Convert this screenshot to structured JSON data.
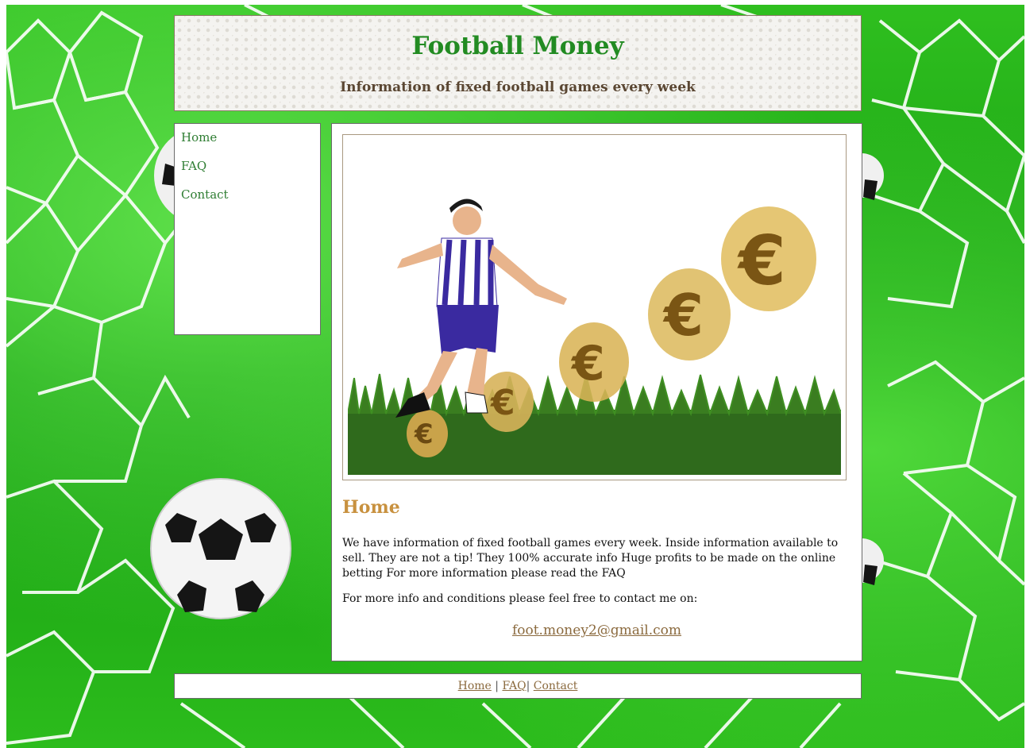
{
  "header": {
    "title": "Football Money",
    "tagline": "Information of fixed football games every week"
  },
  "sidebar": {
    "items": [
      {
        "label": "Home"
      },
      {
        "label": "FAQ"
      },
      {
        "label": "Contact"
      }
    ]
  },
  "main": {
    "heading": "Home",
    "intro": "We have information of fixed football games every week. Inside information available to sell. They are not a tip! They 100% accurate info Huge profits to be made on the online betting For more information please read the FAQ",
    "contact_text": "For more info and conditions please feel free to contact me on:",
    "email": "foot.money2@gmail.com"
  },
  "footer": {
    "links": [
      {
        "label": "Home"
      },
      {
        "label": "FAQ"
      },
      {
        "label": "Contact"
      }
    ],
    "separator": "|"
  },
  "colors": {
    "title": "#228b22",
    "tagline": "#5a4632",
    "nav": "#2e7d32",
    "heading": "#c8913f",
    "link": "#8b6a3e",
    "background_green": "#139a10"
  },
  "icons": {
    "background": "football-net-background",
    "hero": "footballer-kicking-euro-coins-image"
  }
}
